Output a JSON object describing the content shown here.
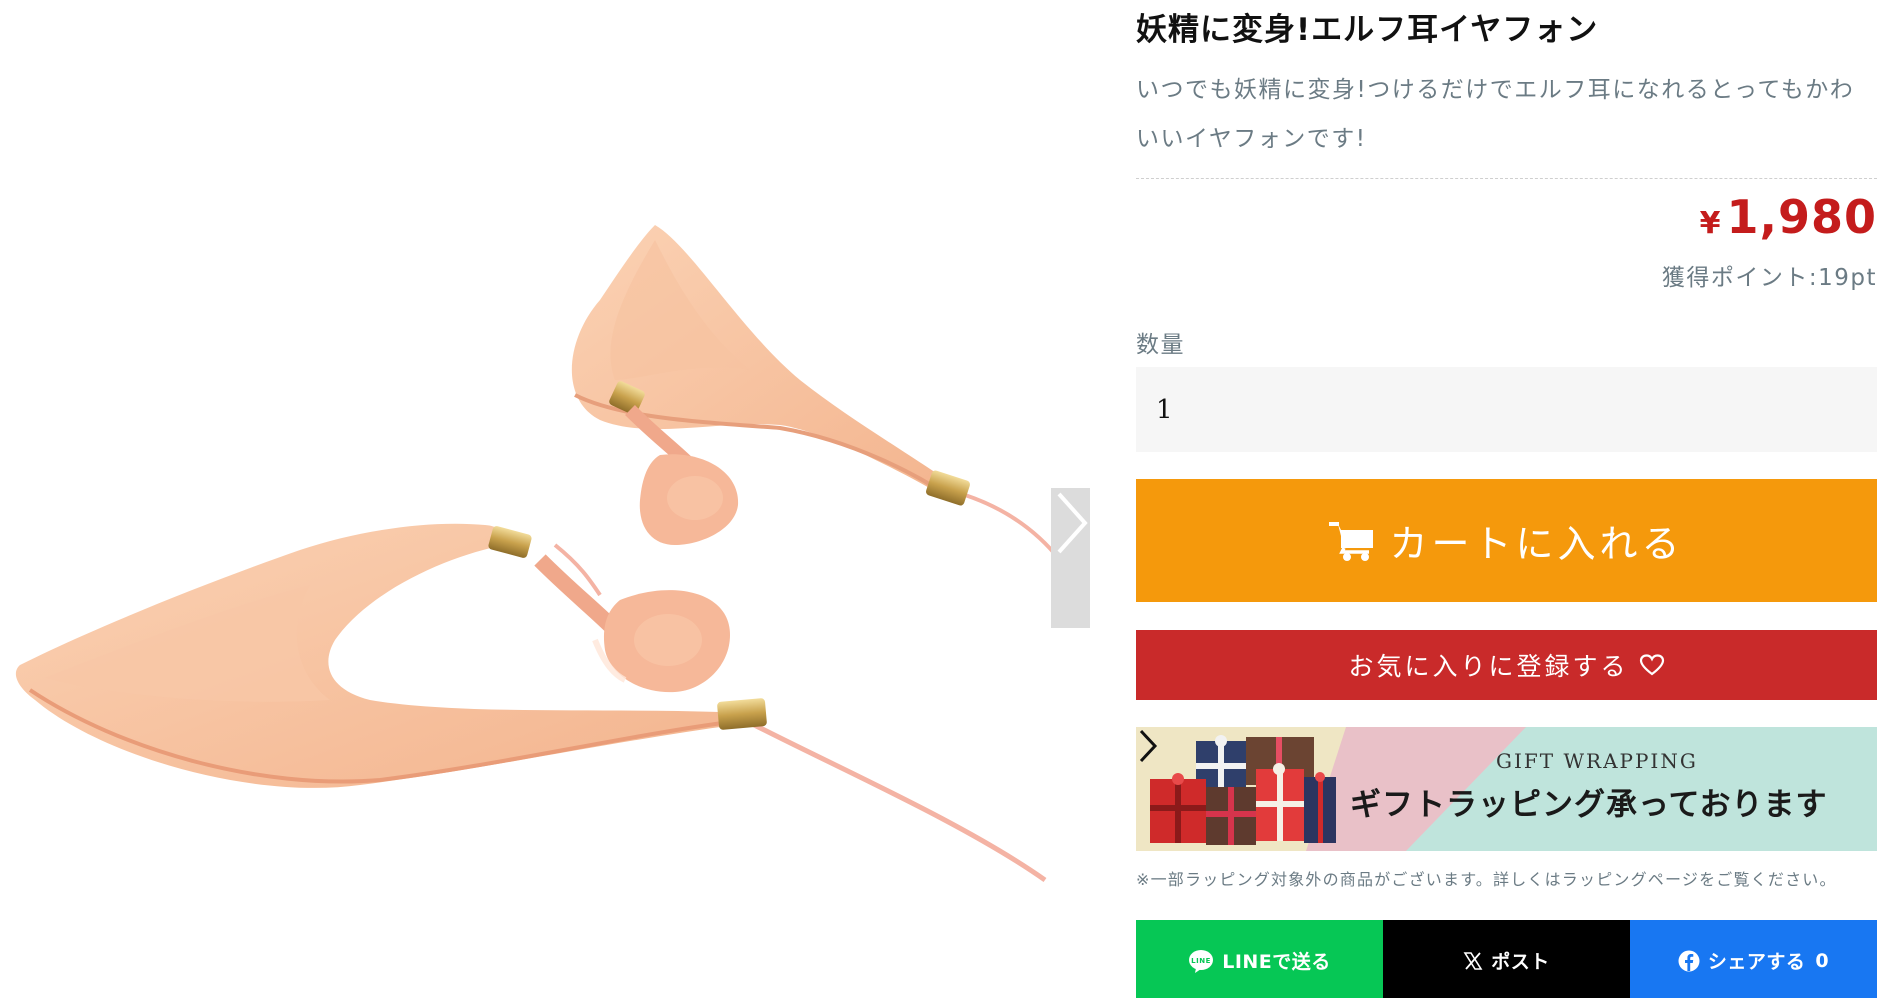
{
  "product": {
    "title": "妖精に変身!エルフ耳イヤフォン",
    "description": "いつでも妖精に変身!つけるだけでエルフ耳になれるとってもかわいいイヤフォンです!",
    "price_symbol": "¥",
    "price": "1,980",
    "points": "獲得ポイント:19pt"
  },
  "quantity": {
    "label": "数量",
    "value": "1"
  },
  "actions": {
    "cart_label": "カートに入れる",
    "favorite_label": "お気に入りに登録する"
  },
  "gift": {
    "subtitle": "GIFT WRAPPING",
    "title": "ギフトラッピング承っております",
    "note": "※一部ラッピング対象外の商品がございます。詳しくはラッピングページをご覧ください。"
  },
  "share": {
    "line_label": "LINEで送る",
    "x_label": "ポスト",
    "facebook_label": "シェアする",
    "facebook_count": "0"
  },
  "colors": {
    "cart": "#f5990c",
    "favorite": "#c92a2a",
    "price": "#c41c1c",
    "line": "#06c755",
    "x": "#000000",
    "facebook": "#1877f2"
  },
  "icons": [
    "chevron-right-icon",
    "cart-icon",
    "heart-icon",
    "line-icon",
    "x-logo-icon",
    "facebook-icon"
  ]
}
